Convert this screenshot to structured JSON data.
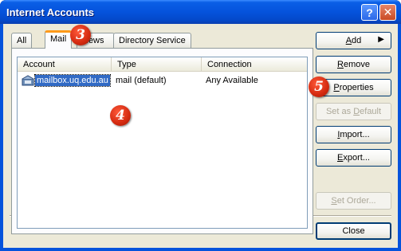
{
  "window": {
    "title": "Internet Accounts",
    "help": "?",
    "close": "✕"
  },
  "tabs": [
    {
      "label": "All"
    },
    {
      "label": "Mail"
    },
    {
      "label": "News"
    },
    {
      "label": "Directory Service"
    }
  ],
  "list": {
    "columns": [
      "Account",
      "Type",
      "Connection"
    ],
    "rows": [
      {
        "account": "mailbox.uq.edu.au",
        "type": "mail (default)",
        "connection": "Any Available"
      }
    ]
  },
  "buttons": {
    "add": {
      "u": "A",
      "rest": "dd"
    },
    "remove": {
      "u": "R",
      "rest": "emove"
    },
    "properties": {
      "u": "P",
      "rest": "roperties"
    },
    "set_default": {
      "pre": "Set as ",
      "u": "D",
      "rest": "efault"
    },
    "import": {
      "u": "I",
      "rest": "mport..."
    },
    "export": {
      "u": "E",
      "rest": "xport..."
    },
    "set_order": {
      "u": "S",
      "rest": "et Order..."
    },
    "close": "Close"
  },
  "annotations": [
    "3",
    "4",
    "5"
  ]
}
